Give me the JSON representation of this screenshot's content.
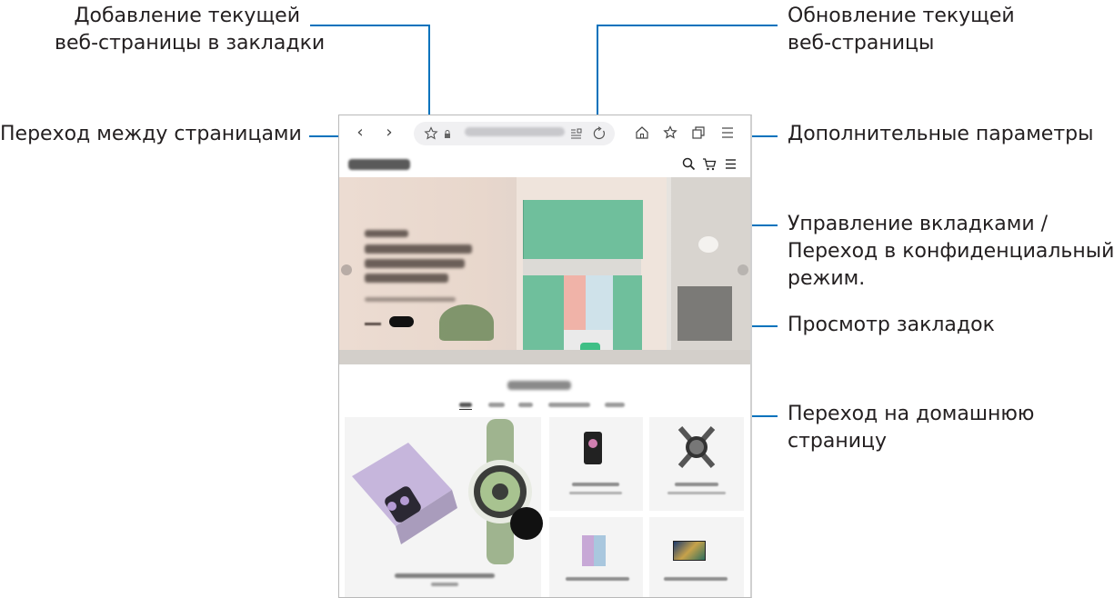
{
  "callouts": {
    "add_bookmark": [
      "Добавление текущей",
      "веб-страницы в закладки"
    ],
    "navigate": "Переход между страницами",
    "refresh": [
      "Обновление текущей",
      "веб-страницы"
    ],
    "more_options": "Дополнительные параметры",
    "tabs": [
      "Управление вкладками /",
      "Переход в конфиденциальный",
      "режим."
    ],
    "view_bookmarks": "Просмотр закладок",
    "home": [
      "Переход на домашнюю",
      "страницу"
    ]
  },
  "icons": {
    "back": "chevron-left-icon",
    "forward": "chevron-right-icon",
    "bookmark_star": "star-icon",
    "lock": "lock-icon",
    "reader": "reader-mode-icon",
    "refresh": "refresh-icon",
    "home": "home-icon",
    "bookmarks": "bookmarks-icon",
    "tabs": "tabs-icon",
    "menu": "menu-icon",
    "search": "search-icon",
    "cart": "cart-icon"
  },
  "colors": {
    "callout_line": "#0072bc",
    "hero_bg": "#ecdcd2",
    "cabinet_green": "#6fbf9c"
  }
}
